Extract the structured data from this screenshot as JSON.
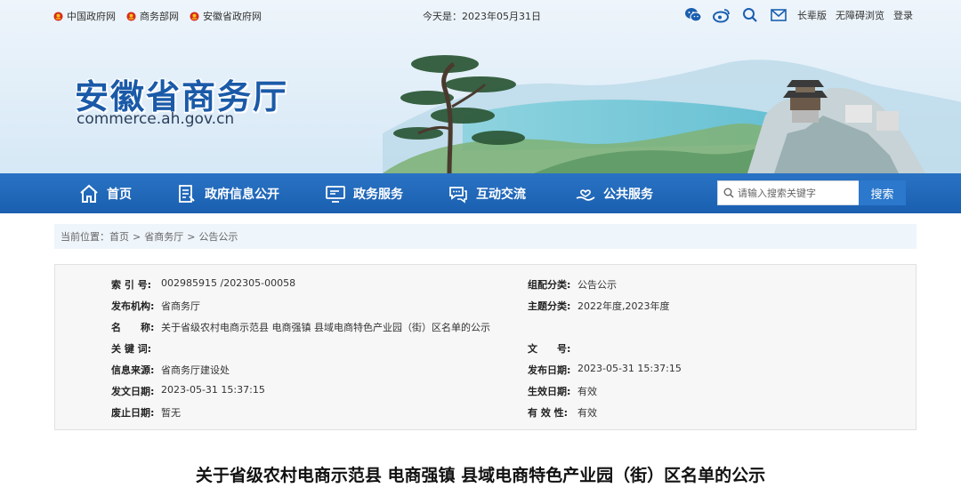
{
  "topbar": {
    "links": [
      {
        "label": "中国政府网"
      },
      {
        "label": "商务部网"
      },
      {
        "label": "安徽省政府网"
      }
    ],
    "today": "今天是：2023年05月31日",
    "right_links": [
      "长辈版",
      "无障碍浏览",
      "登录"
    ]
  },
  "header": {
    "title": "安徽省商务厅",
    "domain": "commerce.ah.gov.cn"
  },
  "nav": {
    "items": [
      {
        "label": "首页",
        "icon": "home-icon"
      },
      {
        "label": "政府信息公开",
        "icon": "document-icon"
      },
      {
        "label": "政务服务",
        "icon": "monitor-icon"
      },
      {
        "label": "互动交流",
        "icon": "chat-icon"
      },
      {
        "label": "公共服务",
        "icon": "hand-heart-icon"
      }
    ],
    "search_placeholder": "请输入搜索关键字",
    "search_button": "搜索"
  },
  "breadcrumb": {
    "prefix": "当前位置：",
    "items": [
      "首页",
      "省商务厅",
      "公告公示"
    ],
    "separator": ">"
  },
  "info": {
    "left": [
      {
        "label": "索 引 号:",
        "value": "002985915 /202305-00058"
      },
      {
        "label": "发布机构:",
        "value": "省商务厅"
      },
      {
        "label": "名　　称:",
        "value": "关于省级农村电商示范县 电商强镇 县域电商特色产业园（街）区名单的公示"
      },
      {
        "label": "关 键 词:",
        "value": ""
      },
      {
        "label": "信息来源:",
        "value": "省商务厅建设处"
      },
      {
        "label": "发文日期:",
        "value": "2023-05-31 15:37:15"
      },
      {
        "label": "废止日期:",
        "value": "暂无"
      }
    ],
    "right": [
      {
        "label": "组配分类:",
        "value": "公告公示"
      },
      {
        "label": "主题分类:",
        "value": "2022年度,2023年度"
      },
      {
        "label": "",
        "value": ""
      },
      {
        "label": "文　　号:",
        "value": ""
      },
      {
        "label": "发布日期:",
        "value": "2023-05-31 15:37:15"
      },
      {
        "label": "生效日期:",
        "value": "有效"
      },
      {
        "label": "有 效 性:",
        "value": "有效"
      }
    ]
  },
  "article": {
    "title": "关于省级农村电商示范县 电商强镇 县域电商特色产业园（街）区名单的公示"
  },
  "colors": {
    "brand_blue": "#1a5fb0",
    "title_blue": "#1a5aa8",
    "emblem_red": "#d62b1e"
  }
}
